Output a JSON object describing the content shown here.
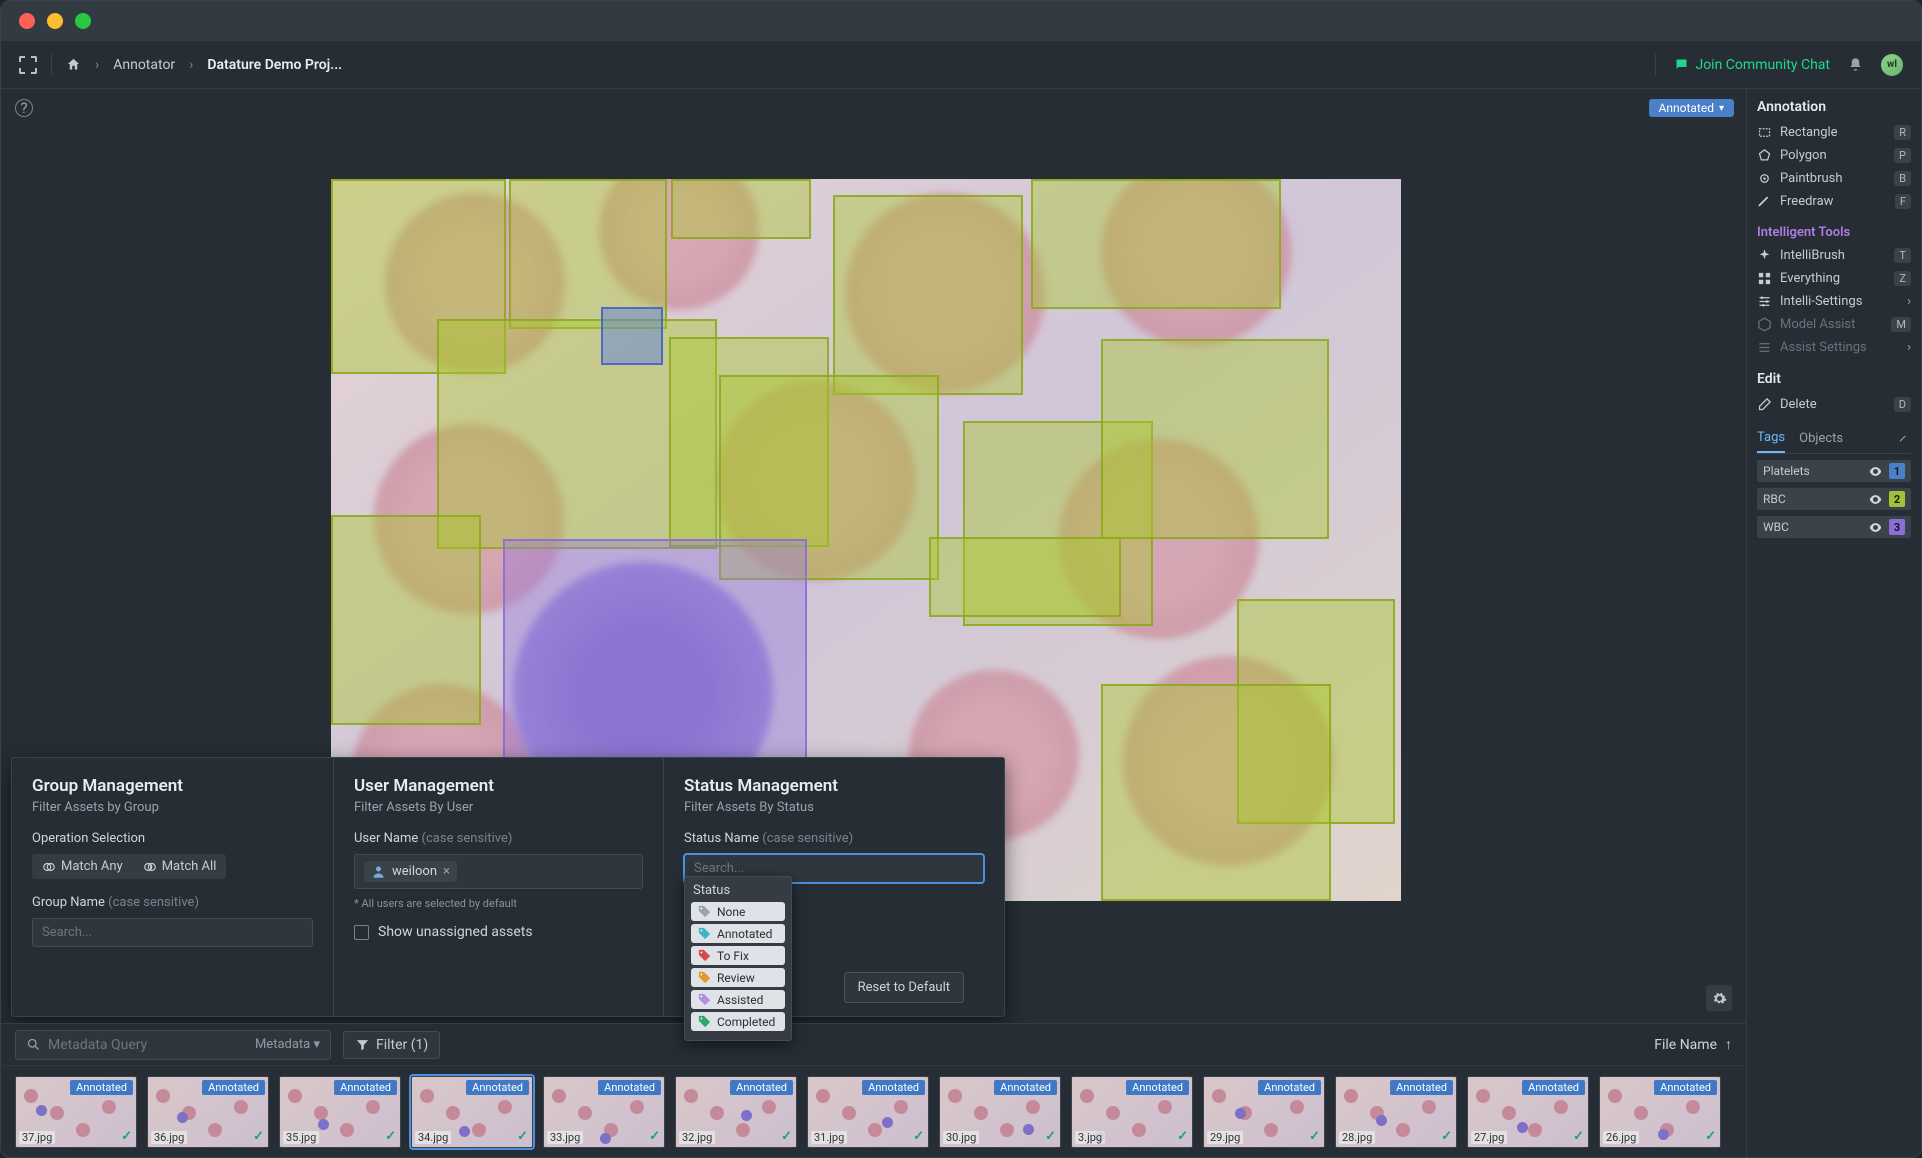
{
  "breadcrumb": {
    "annotator": "Annotator",
    "project": "Datature Demo Proj..."
  },
  "topRight": {
    "community": "Join Community Chat",
    "avatar_initials": "wl"
  },
  "statusBadge": "Annotated",
  "rightPanel": {
    "annotation_title": "Annotation",
    "rectangle": "Rectangle",
    "rectangle_key": "R",
    "polygon": "Polygon",
    "polygon_key": "P",
    "paintbrush": "Paintbrush",
    "paintbrush_key": "B",
    "freedraw": "Freedraw",
    "freedraw_key": "F",
    "intelligent_title": "Intelligent Tools",
    "intellibrush": "IntelliBrush",
    "intellibrush_key": "T",
    "everything": "Everything",
    "everything_key": "Z",
    "intelli_settings": "Intelli-Settings",
    "model_assist": "Model Assist",
    "model_assist_key": "M",
    "assist_settings": "Assist Settings",
    "edit_title": "Edit",
    "delete": "Delete",
    "delete_key": "D",
    "tabs": {
      "tags": "Tags",
      "objects": "Objects"
    },
    "class_tags": [
      {
        "name": "Platelets",
        "count": 1,
        "color": "#4a7fc9"
      },
      {
        "name": "RBC",
        "count": 2,
        "color": "#9fc23a"
      },
      {
        "name": "WBC",
        "count": 3,
        "color": "#8a6fd6"
      }
    ]
  },
  "filterPanel": {
    "group": {
      "title": "Group Management",
      "sub": "Filter Assets by Group",
      "op_label": "Operation Selection",
      "match_any": "Match Any",
      "match_all": "Match All",
      "group_name_label": "Group Name",
      "case_sensitive": " (case sensitive)",
      "search_placeholder": "Search..."
    },
    "user": {
      "title": "User Management",
      "sub": "Filter Assets By User",
      "user_name_label": "User Name",
      "selected_user": "weiloon",
      "note": "* All users are selected by default",
      "show_unassigned": "Show unassigned assets"
    },
    "status": {
      "title": "Status Management",
      "sub": "Filter Assets By Status",
      "status_name_label": "Status Name",
      "search_placeholder": "Search...",
      "dropdown_title": "Status",
      "options": [
        {
          "label": "None",
          "color": "#9aa2aa"
        },
        {
          "label": "Annotated",
          "color": "#3ab6c9"
        },
        {
          "label": "To Fix",
          "color": "#d64a4a"
        },
        {
          "label": "Review",
          "color": "#e09a2b"
        },
        {
          "label": "Assisted",
          "color": "#b38ee0"
        },
        {
          "label": "Completed",
          "color": "#2fa866"
        }
      ],
      "reset": "Reset to Default"
    }
  },
  "bottomBar": {
    "meta_placeholder": "Metadata Query",
    "meta_label": "Metadata",
    "filter_label": "Filter (1)",
    "sort_label": "File Name",
    "thumbs": [
      {
        "name": "37.jpg",
        "status": "Annotated"
      },
      {
        "name": "36.jpg",
        "status": "Annotated"
      },
      {
        "name": "35.jpg",
        "status": "Annotated"
      },
      {
        "name": "34.jpg",
        "status": "Annotated",
        "selected": true
      },
      {
        "name": "33.jpg",
        "status": "Annotated"
      },
      {
        "name": "32.jpg",
        "status": "Annotated"
      },
      {
        "name": "31.jpg",
        "status": "Annotated"
      },
      {
        "name": "30.jpg",
        "status": "Annotated"
      },
      {
        "name": "3.jpg",
        "status": "Annotated"
      },
      {
        "name": "29.jpg",
        "status": "Annotated"
      },
      {
        "name": "28.jpg",
        "status": "Annotated"
      },
      {
        "name": "27.jpg",
        "status": "Annotated"
      },
      {
        "name": "26.jpg",
        "status": "Annotated"
      }
    ]
  }
}
